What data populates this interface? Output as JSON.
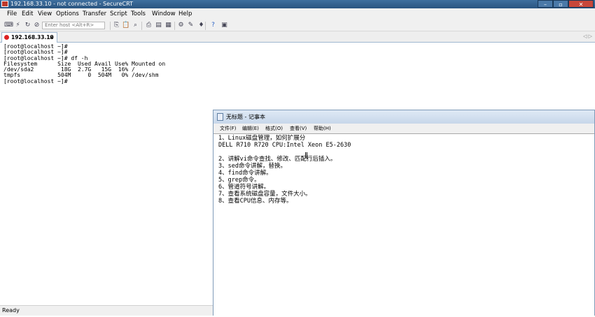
{
  "window": {
    "title": "192.168.33.10 - not connected - SecureCRT",
    "min": "–",
    "max": "▫",
    "close": "✕"
  },
  "menu": [
    "File",
    "Edit",
    "View",
    "Options",
    "Transfer",
    "Script",
    "Tools",
    "Window",
    "Help"
  ],
  "toolbar": {
    "host_placeholder": "Enter host <Alt+R>",
    "icons_left": [
      "connect-icon",
      "quick-connect-icon",
      "reconnect-icon",
      "disconnect-icon"
    ],
    "icons_right": [
      "copy-icon",
      "paste-icon",
      "find-icon",
      "print-icon",
      "print-screen-icon",
      "log-icon",
      "settings-icon",
      "keymap-icon",
      "help-icon",
      "session-icon"
    ]
  },
  "tab": {
    "label": "192.168.33.10",
    "close": "×",
    "arrows": "◁ ▷"
  },
  "terminal": {
    "lines": [
      "[root@localhost ~]#",
      "[root@localhost ~]#",
      "[root@localhost ~]# df -h",
      "Filesystem      Size  Used Avail Use% Mounted on",
      "/dev/sda2        18G  2.7G   15G  16% /",
      "tmpfs           504M     0  504M   0% /dev/shm",
      "[root@localhost ~]#"
    ]
  },
  "notepad": {
    "title": "无标题 - 记事本",
    "menu": [
      "文件(F)",
      "编辑(E)",
      "格式(O)",
      "查看(V)",
      "帮助(H)"
    ],
    "lines": [
      "1、Linux磁盘管理，如何扩展分",
      "DELL R710 R720 CPU:Intel Xeon E5-2630",
      "",
      "2、讲解vi命令查找、修改、匹配行后插入。",
      "3、sed命令讲解，替换。",
      "4、find命令讲解。",
      "5、grep命令。",
      "6、管道符号讲解。",
      "7、查看系统磁盘容量，文件大小。",
      "8、查看CPU信息、内存等。"
    ]
  },
  "status": {
    "text": "Ready"
  }
}
